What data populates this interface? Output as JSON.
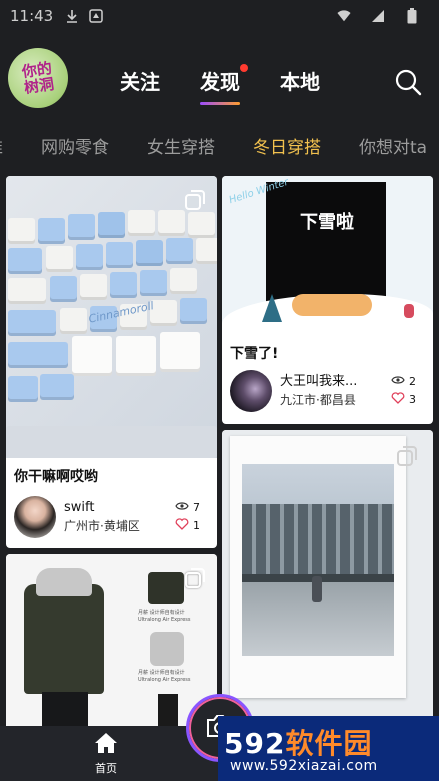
{
  "status_bar": {
    "time": "11:43",
    "icons": [
      "download-icon",
      "notification-icon",
      "wifi-icon",
      "signal-icon",
      "battery-icon"
    ]
  },
  "header": {
    "logo_text": "你的树洞",
    "tabs": [
      {
        "label": "关注",
        "active": false,
        "has_dot": false
      },
      {
        "label": "发现",
        "active": true,
        "has_dot": true
      },
      {
        "label": "本地",
        "active": false,
        "has_dot": false
      }
    ],
    "search_icon": "search-icon"
  },
  "categories": [
    {
      "label": "推",
      "active": false
    },
    {
      "label": "网购零食",
      "active": false
    },
    {
      "label": "女生穿搭",
      "active": false
    },
    {
      "label": "冬日穿搭",
      "active": true
    },
    {
      "label": "你想对ta",
      "active": false
    }
  ],
  "feed": {
    "card1": {
      "caption": "你干嘛啊哎哟",
      "user_name": "swift",
      "location": "广州市·黄埔区",
      "views": "7",
      "likes": "1",
      "photo_text": "Cinnamoroll"
    },
    "card2": {
      "caption": "下雪了!",
      "user_name": "大王叫我来...",
      "location": "九江市·都昌县",
      "views": "2",
      "likes": "3",
      "photo_text": "下雪啦",
      "photo_subtext": "Hello Winter"
    },
    "card3": {
      "caption": "",
      "product_text_1": "月薪 设计师自有设计 Ultralong Air Express",
      "product_text_2": "月薪 设计师自有设计 Ultralong Air Express"
    },
    "card4": {
      "caption": ""
    }
  },
  "bottom_nav": {
    "home_label": "首页",
    "camera_icon": "camera-icon"
  },
  "watermark": {
    "brand_num": "592",
    "brand_cn": "软件园",
    "url": "www.592xiazai.com"
  },
  "colors": {
    "background": "#1e1f22",
    "active_category": "#f2c14e",
    "tab_underline_start": "#9b4dff",
    "tab_underline_end": "#ff9d2e",
    "notification_dot": "#ff3b30",
    "like_heart": "#e0405a",
    "watermark_bg": "#0b2a7a",
    "watermark_accent": "#ff8a2a"
  }
}
